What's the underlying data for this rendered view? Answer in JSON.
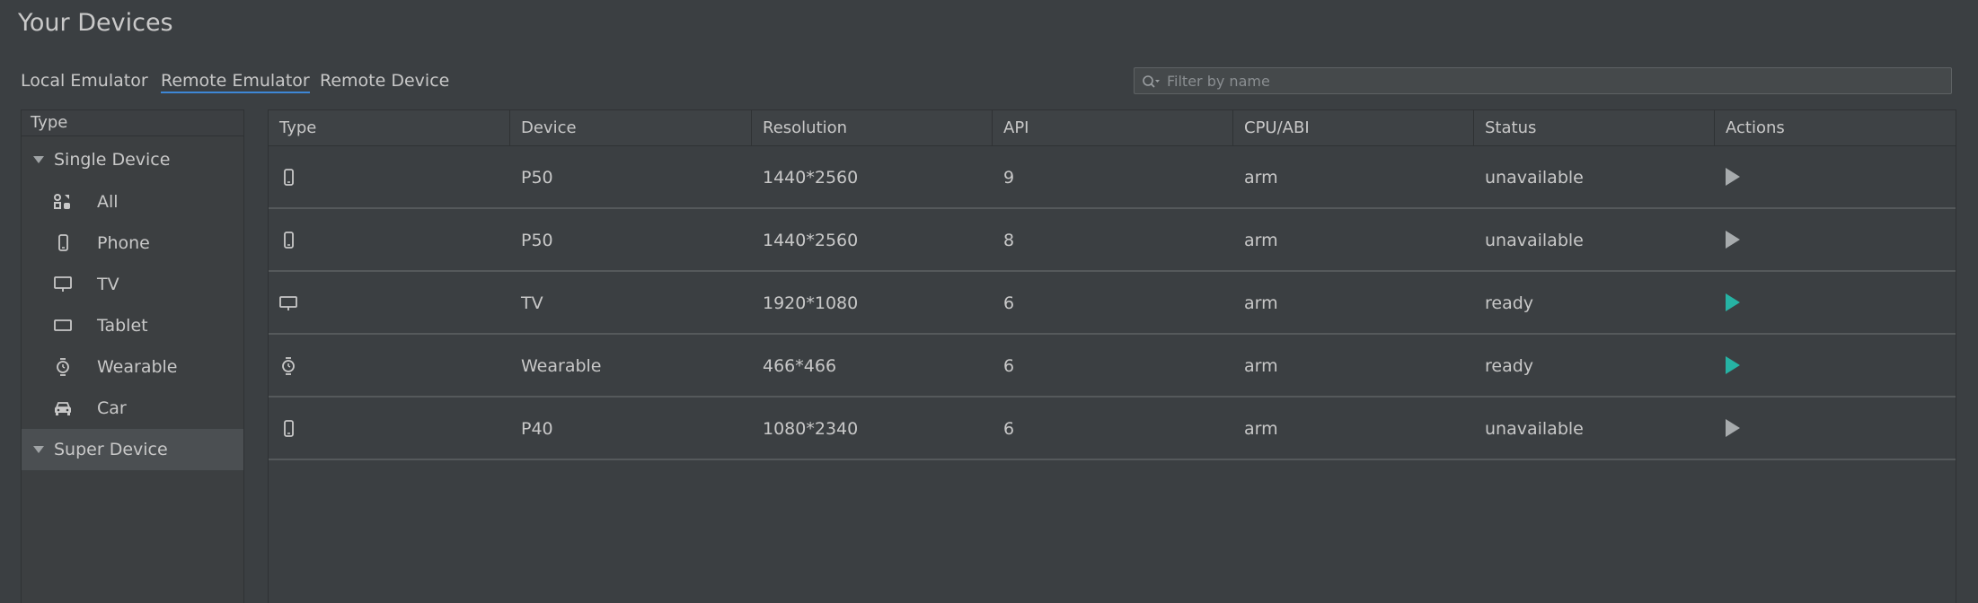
{
  "page": {
    "title": "Your Devices"
  },
  "tabs": [
    {
      "label": "Local Emulator",
      "active": false
    },
    {
      "label": "Remote Emulator",
      "active": true
    },
    {
      "label": "Remote Device",
      "active": false
    }
  ],
  "filter": {
    "placeholder": "Filter by name",
    "value": "",
    "icon": "search-icon"
  },
  "sidebar": {
    "header": "Type",
    "groups": [
      {
        "label": "Single Device",
        "expanded": true,
        "selected": false
      },
      {
        "label": "Super Device",
        "expanded": true,
        "selected": true
      }
    ],
    "items": [
      {
        "label": "All",
        "icon": "all-icon"
      },
      {
        "label": "Phone",
        "icon": "phone-icon"
      },
      {
        "label": "TV",
        "icon": "tv-icon"
      },
      {
        "label": "Tablet",
        "icon": "tablet-icon"
      },
      {
        "label": "Wearable",
        "icon": "watch-icon"
      },
      {
        "label": "Car",
        "icon": "car-icon"
      }
    ]
  },
  "table": {
    "columns": [
      "Type",
      "Device",
      "Resolution",
      "API",
      "CPU/ABI",
      "Status",
      "Actions"
    ],
    "rows": [
      {
        "type_icon": "phone-icon",
        "device": "P50",
        "resolution": "1440*2560",
        "api": "9",
        "cpu": "arm",
        "status": "unavailable"
      },
      {
        "type_icon": "phone-icon",
        "device": "P50",
        "resolution": "1440*2560",
        "api": "8",
        "cpu": "arm",
        "status": "unavailable"
      },
      {
        "type_icon": "tv-icon",
        "device": "TV",
        "resolution": "1920*1080",
        "api": "6",
        "cpu": "arm",
        "status": "ready"
      },
      {
        "type_icon": "watch-icon",
        "device": "Wearable",
        "resolution": "466*466",
        "api": "6",
        "cpu": "arm",
        "status": "ready"
      },
      {
        "type_icon": "phone-icon",
        "device": "P40",
        "resolution": "1080*2340",
        "api": "6",
        "cpu": "arm",
        "status": "unavailable"
      }
    ]
  },
  "colors": {
    "background": "#3b3f42",
    "text": "#c8c8c8",
    "tab_underline": "#3e87d6",
    "play_ready": "#26b3a4",
    "play_unavailable": "#a7abad",
    "selected_row": "#4b4f52"
  }
}
